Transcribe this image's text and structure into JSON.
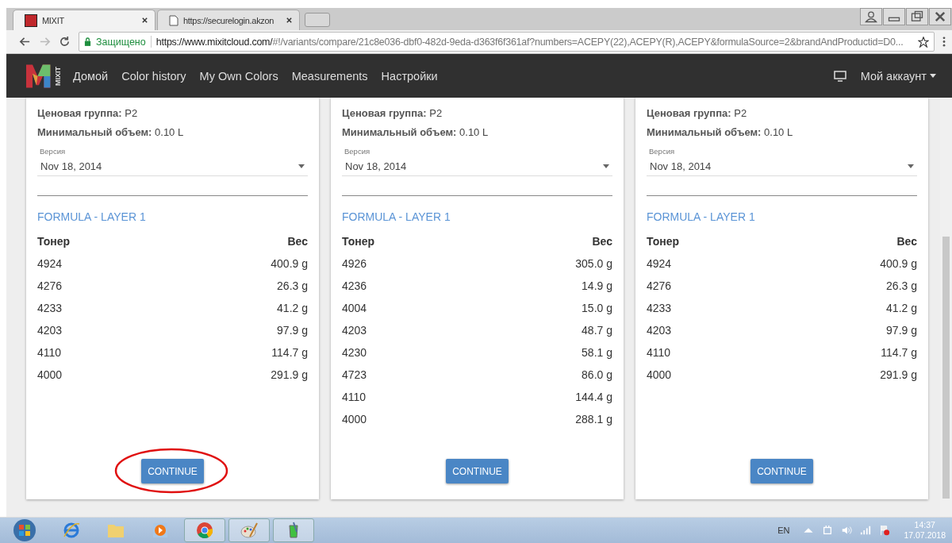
{
  "browser": {
    "tabs": [
      {
        "title": "MIXIT",
        "selected": true,
        "kind": "app"
      },
      {
        "title": "https://securelogin.akzon",
        "selected": false,
        "kind": "page"
      }
    ],
    "security": "Защищено",
    "url_host": "https://www.mixitcloud.com/",
    "url_path": "#!/variants/compare/21c8e036-dbf0-482d-9eda-d363f6f361af?numbers=ACEPY(22),ACEPY(R),ACEPY&formulaSource=2&brandAndProductid=D0..."
  },
  "nav": {
    "logo_text": "MIXIT",
    "items": [
      "Домой",
      "Color history",
      "My Own Colors",
      "Measurements",
      "Настройки"
    ],
    "account": "Мой аккаунт"
  },
  "cards": [
    {
      "price_label": "Ценовая группа:",
      "price": "P2",
      "min_label": "Минимальный объем:",
      "min": "0.10 L",
      "version_label": "Версия",
      "version": "Nov 18, 2014",
      "formula_title": "FORMULA - LAYER 1",
      "col_toner": "Тонер",
      "col_weight": "Вес",
      "rows": [
        [
          "4924",
          "400.9 g"
        ],
        [
          "4276",
          "26.3 g"
        ],
        [
          "4233",
          "41.2 g"
        ],
        [
          "4203",
          "97.9 g"
        ],
        [
          "4110",
          "114.7 g"
        ],
        [
          "4000",
          "291.9 g"
        ]
      ],
      "button": "CONTINUE",
      "circled": true
    },
    {
      "price_label": "Ценовая группа:",
      "price": "P2",
      "min_label": "Минимальный объем:",
      "min": "0.10 L",
      "version_label": "Версия",
      "version": "Nov 18, 2014",
      "formula_title": "FORMULA - LAYER 1",
      "col_toner": "Тонер",
      "col_weight": "Вес",
      "rows": [
        [
          "4926",
          "305.0 g"
        ],
        [
          "4236",
          "14.9 g"
        ],
        [
          "4004",
          "15.0 g"
        ],
        [
          "4203",
          "48.7 g"
        ],
        [
          "4230",
          "58.1 g"
        ],
        [
          "4723",
          "86.0 g"
        ],
        [
          "4110",
          "144.4 g"
        ],
        [
          "4000",
          "288.1 g"
        ]
      ],
      "button": "CONTINUE",
      "circled": false
    },
    {
      "price_label": "Ценовая группа:",
      "price": "P2",
      "min_label": "Минимальный объем:",
      "min": "0.10 L",
      "version_label": "Версия",
      "version": "Nov 18, 2014",
      "formula_title": "FORMULA - LAYER 1",
      "col_toner": "Тонер",
      "col_weight": "Вес",
      "rows": [
        [
          "4924",
          "400.9 g"
        ],
        [
          "4276",
          "26.3 g"
        ],
        [
          "4233",
          "41.2 g"
        ],
        [
          "4203",
          "97.9 g"
        ],
        [
          "4110",
          "114.7 g"
        ],
        [
          "4000",
          "291.9 g"
        ]
      ],
      "button": "CONTINUE",
      "circled": false
    }
  ],
  "taskbar": {
    "apps": [
      {
        "kind": "ie",
        "selected": false
      },
      {
        "kind": "folder",
        "selected": false
      },
      {
        "kind": "media",
        "selected": false
      },
      {
        "kind": "chrome",
        "selected": true
      },
      {
        "kind": "paint",
        "selected": true
      },
      {
        "kind": "beaker",
        "selected": true
      }
    ],
    "language": "EN",
    "time": "14:37",
    "date": "17.07.2018"
  }
}
